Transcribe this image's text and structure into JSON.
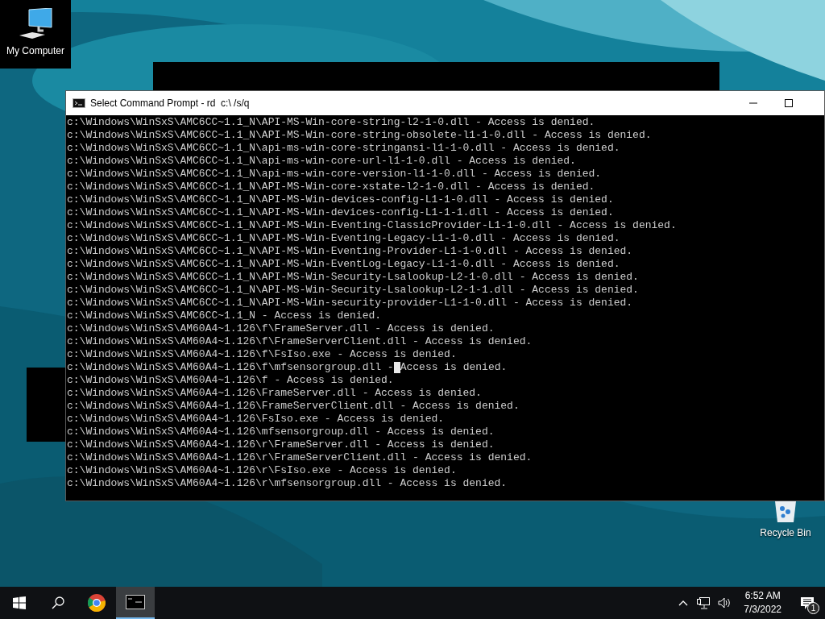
{
  "desktop_icons": [
    {
      "kind": "computer",
      "label": "My Computer",
      "selected": true
    },
    {
      "kind": "recycle",
      "label": "Recycle Bin",
      "selected": false
    }
  ],
  "window": {
    "title": "Select Command Prompt - rd  c:\\ /s/q",
    "lines": [
      {
        "text": "c:\\Windows\\WinSxS\\AMC6CC~1.1_N\\API-MS-Win-core-string-l2-1-0.dll - Access is denied."
      },
      {
        "text": "c:\\Windows\\WinSxS\\AMC6CC~1.1_N\\API-MS-Win-core-string-obsolete-l1-1-0.dll - Access is denied."
      },
      {
        "text": "c:\\Windows\\WinSxS\\AMC6CC~1.1_N\\api-ms-win-core-stringansi-l1-1-0.dll - Access is denied."
      },
      {
        "text": "c:\\Windows\\WinSxS\\AMC6CC~1.1_N\\api-ms-win-core-url-l1-1-0.dll - Access is denied."
      },
      {
        "text": "c:\\Windows\\WinSxS\\AMC6CC~1.1_N\\api-ms-win-core-version-l1-1-0.dll - Access is denied."
      },
      {
        "text": "c:\\Windows\\WinSxS\\AMC6CC~1.1_N\\API-MS-Win-core-xstate-l2-1-0.dll - Access is denied."
      },
      {
        "text": "c:\\Windows\\WinSxS\\AMC6CC~1.1_N\\API-MS-Win-devices-config-L1-1-0.dll - Access is denied."
      },
      {
        "text": "c:\\Windows\\WinSxS\\AMC6CC~1.1_N\\API-MS-Win-devices-config-L1-1-1.dll - Access is denied."
      },
      {
        "text": "c:\\Windows\\WinSxS\\AMC6CC~1.1_N\\API-MS-Win-Eventing-ClassicProvider-L1-1-0.dll - Access is denied."
      },
      {
        "text": "c:\\Windows\\WinSxS\\AMC6CC~1.1_N\\API-MS-Win-Eventing-Legacy-L1-1-0.dll - Access is denied."
      },
      {
        "text": "c:\\Windows\\WinSxS\\AMC6CC~1.1_N\\API-MS-Win-Eventing-Provider-L1-1-0.dll - Access is denied."
      },
      {
        "text": "c:\\Windows\\WinSxS\\AMC6CC~1.1_N\\API-MS-Win-EventLog-Legacy-L1-1-0.dll - Access is denied."
      },
      {
        "text": "c:\\Windows\\WinSxS\\AMC6CC~1.1_N\\API-MS-Win-Security-Lsalookup-L2-1-0.dll - Access is denied."
      },
      {
        "text": "c:\\Windows\\WinSxS\\AMC6CC~1.1_N\\API-MS-Win-Security-Lsalookup-L2-1-1.dll - Access is denied."
      },
      {
        "text": "c:\\Windows\\WinSxS\\AMC6CC~1.1_N\\API-MS-Win-security-provider-L1-1-0.dll - Access is denied."
      },
      {
        "text": "c:\\Windows\\WinSxS\\AMC6CC~1.1_N - Access is denied."
      },
      {
        "text": "c:\\Windows\\WinSxS\\AM60A4~1.126\\f\\FrameServer.dll - Access is denied."
      },
      {
        "text": "c:\\Windows\\WinSxS\\AM60A4~1.126\\f\\FrameServerClient.dll - Access is denied."
      },
      {
        "text": "c:\\Windows\\WinSxS\\AM60A4~1.126\\f\\FsIso.exe - Access is denied."
      },
      {
        "text": "c:\\Windows\\WinSxS\\AM60A4~1.126\\f\\mfsensorgroup.dll -",
        "after_cursor": "Access is denied."
      },
      {
        "text": "c:\\Windows\\WinSxS\\AM60A4~1.126\\f - Access is denied."
      },
      {
        "text": "c:\\Windows\\WinSxS\\AM60A4~1.126\\FrameServer.dll - Access is denied."
      },
      {
        "text": "c:\\Windows\\WinSxS\\AM60A4~1.126\\FrameServerClient.dll - Access is denied."
      },
      {
        "text": "c:\\Windows\\WinSxS\\AM60A4~1.126\\FsIso.exe - Access is denied."
      },
      {
        "text": "c:\\Windows\\WinSxS\\AM60A4~1.126\\mfsensorgroup.dll - Access is denied."
      },
      {
        "text": "c:\\Windows\\WinSxS\\AM60A4~1.126\\r\\FrameServer.dll - Access is denied."
      },
      {
        "text": "c:\\Windows\\WinSxS\\AM60A4~1.126\\r\\FrameServerClient.dll - Access is denied."
      },
      {
        "text": "c:\\Windows\\WinSxS\\AM60A4~1.126\\r\\FsIso.exe - Access is denied."
      },
      {
        "text": "c:\\Windows\\WinSxS\\AM60A4~1.126\\r\\mfsensorgroup.dll - Access is denied."
      }
    ]
  },
  "taskbar": {
    "items": [
      {
        "kind": "start",
        "selected": false
      },
      {
        "kind": "search",
        "selected": false
      },
      {
        "kind": "browser",
        "selected": false
      },
      {
        "kind": "console",
        "selected": true
      }
    ],
    "time": "6:52 AM",
    "date": "7/3/2022",
    "notification_count": "1"
  }
}
